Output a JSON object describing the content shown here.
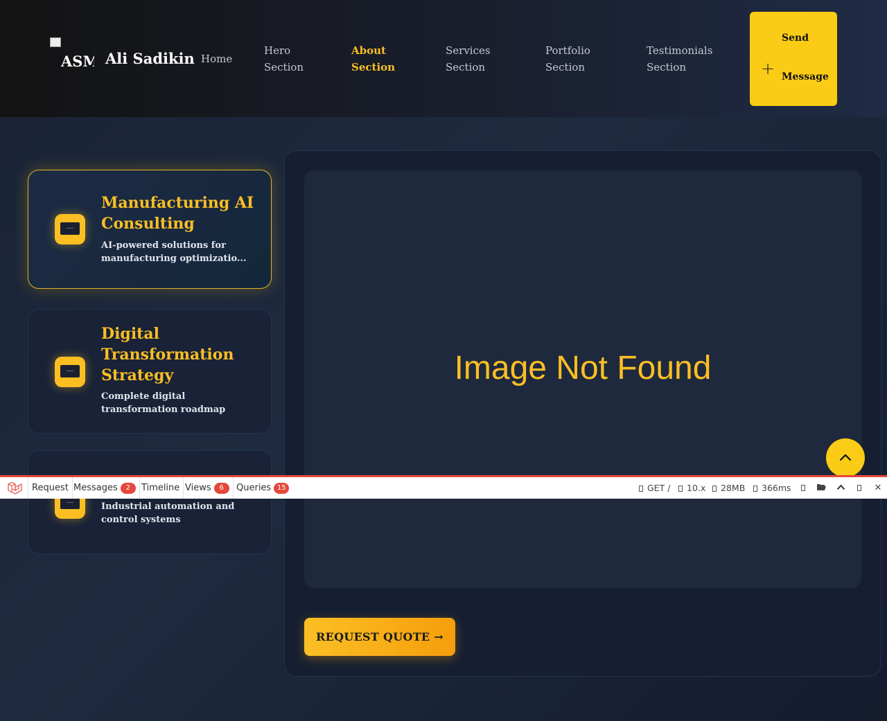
{
  "header": {
    "logo_alt": "ASM",
    "brand": "Ali Sadikin",
    "nav": [
      {
        "line1": "Home",
        "line2": ""
      },
      {
        "line1": "Hero",
        "line2": "Section"
      },
      {
        "line1": "About",
        "line2": "Section"
      },
      {
        "line1": "Services",
        "line2": "Section"
      },
      {
        "line1": "Portfolio",
        "line2": "Section"
      },
      {
        "line1": "Testimonials",
        "line2": "Section"
      }
    ],
    "active_nav": "About Section",
    "send_button": {
      "line1": "Send",
      "line2": "Message",
      "icon": "plus-icon"
    }
  },
  "services": [
    {
      "title": "Manufacturing AI Consulting",
      "desc": "AI-powered solutions for manufacturing optimizatio...",
      "active": true
    },
    {
      "title": "Digital Transformation Strategy",
      "desc": "Complete digital transformation roadmap",
      "active": false
    },
    {
      "title": "",
      "desc": "Industrial automation and control systems",
      "active": false
    }
  ],
  "preview": {
    "image_text": "Image Not Found",
    "cta": "REQUEST QUOTE →"
  },
  "debugbar": {
    "tabs": [
      {
        "label": "Request",
        "badge": ""
      },
      {
        "label": "Messages",
        "badge": "2"
      },
      {
        "label": "Timeline",
        "badge": ""
      },
      {
        "label": "Views",
        "badge": "6"
      },
      {
        "label": "Queries",
        "badge": "15"
      }
    ],
    "stats": {
      "route": "GET /",
      "version": "10.x",
      "memory": "28MB",
      "time": "366ms"
    }
  },
  "colors": {
    "accent": "#fbbf24",
    "button_yellow": "#facc15",
    "debug_red": "#e5473a",
    "background": "#1a2335"
  }
}
